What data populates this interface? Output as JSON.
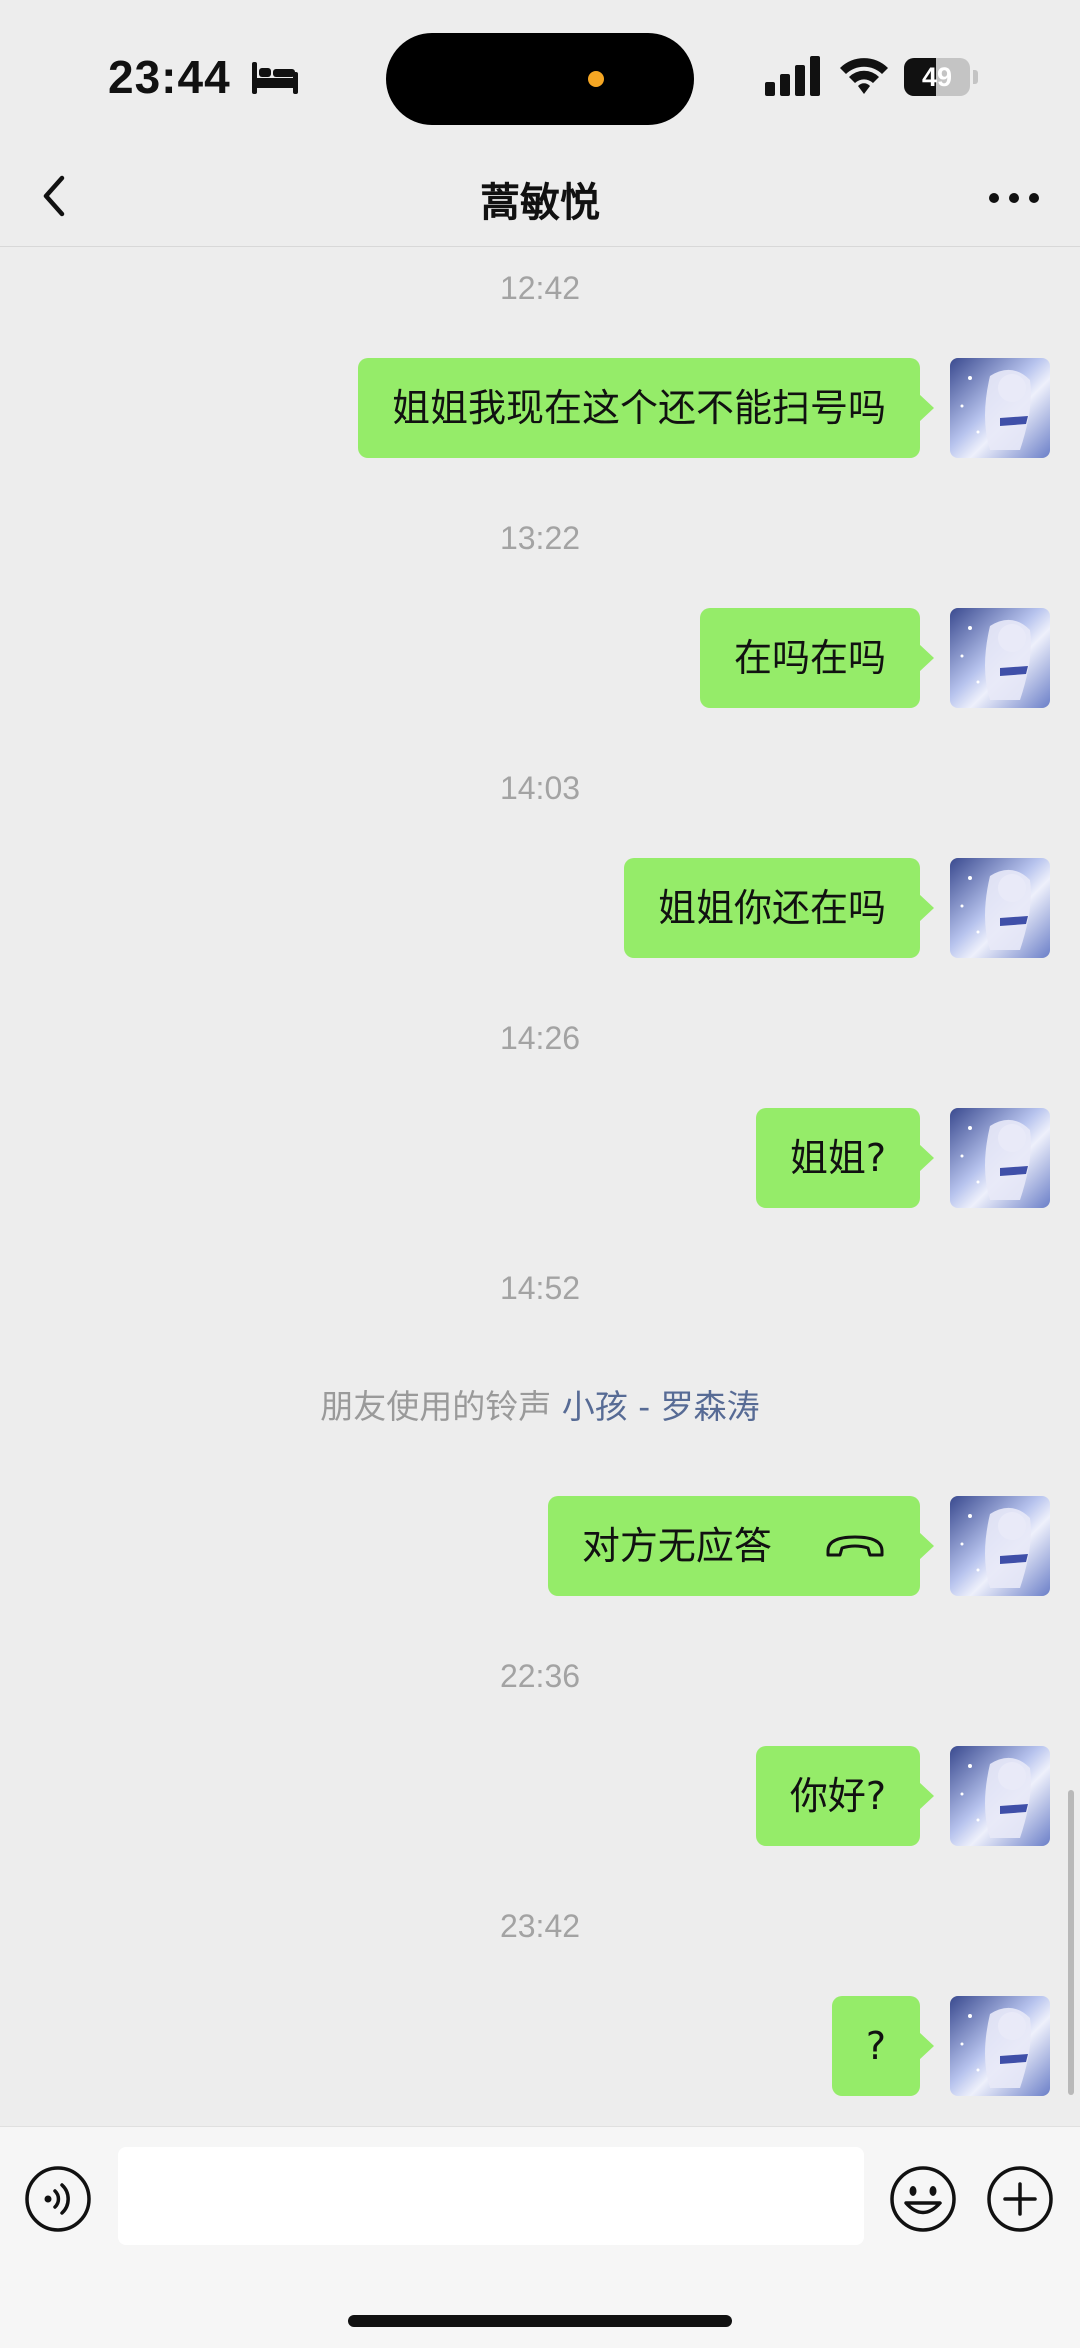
{
  "status_bar": {
    "time": "23:44",
    "battery_percent": 49,
    "battery_label": "49",
    "accent_dot_color": "#f5a623"
  },
  "nav": {
    "title": "蒿敏悦",
    "back_icon": "chevron-left-icon",
    "more_icon": "more-dots-icon"
  },
  "chat": {
    "bubble_color": "#95ec69",
    "link_color": "#576b95",
    "timestamps": [
      "12:42",
      "13:22",
      "14:03",
      "14:26",
      "14:52",
      "22:36",
      "23:42"
    ],
    "messages": [
      {
        "text": "姐姐我现在这个还不能扫号吗",
        "from": "me"
      },
      {
        "text": "在吗在吗",
        "from": "me"
      },
      {
        "text": "姐姐你还在吗",
        "from": "me"
      },
      {
        "text": "姐姐?",
        "from": "me"
      },
      {
        "text": "对方无应答",
        "from": "me",
        "icon": "phone-hangup-icon"
      },
      {
        "text": "你好?",
        "from": "me"
      },
      {
        "text": "?",
        "from": "me"
      }
    ],
    "ringtone_notice": {
      "prefix": "朋友使用的铃声",
      "song": "小孩 - 罗森涛"
    }
  },
  "input_bar": {
    "voice_icon": "voice-icon",
    "emoji_icon": "emoji-icon",
    "plus_icon": "plus-icon",
    "value": ""
  }
}
